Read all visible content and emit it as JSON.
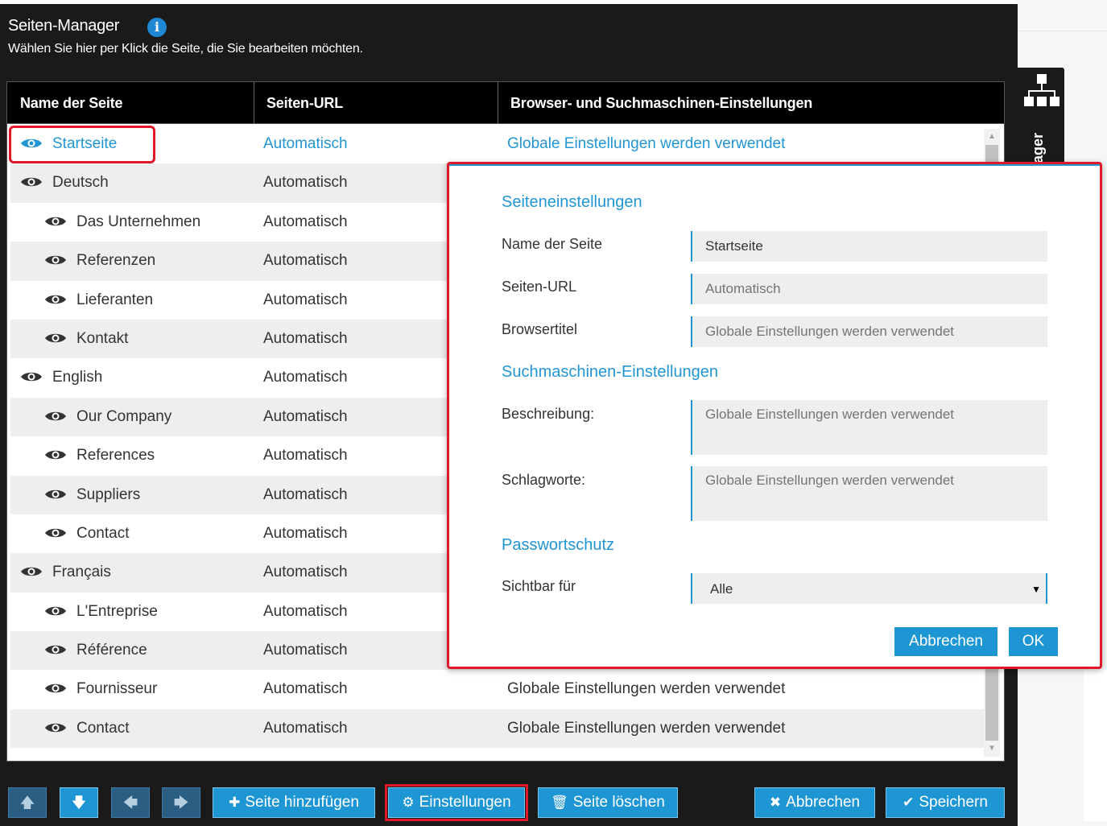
{
  "header": {
    "title": "Seiten-Manager",
    "info_icon": "i",
    "subtitle": "Wählen Sie hier per Klick die Seite, die Sie bearbeiten möchten."
  },
  "side_tab": {
    "label": "ager",
    "icon": "sitemap-icon"
  },
  "table": {
    "columns": [
      "Name der Seite",
      "Seiten-URL",
      "Browser- und Suchmaschinen-Einstellungen"
    ],
    "rows": [
      {
        "name": "Startseite",
        "url": "Automatisch",
        "seo": "Globale Einstellungen werden verwendet"
      },
      {
        "name": "Deutsch",
        "url": "Automatisch",
        "seo": ""
      },
      {
        "name": "Das Unternehmen",
        "url": "Automatisch",
        "seo": ""
      },
      {
        "name": "Referenzen",
        "url": "Automatisch",
        "seo": ""
      },
      {
        "name": "Lieferanten",
        "url": "Automatisch",
        "seo": ""
      },
      {
        "name": "Kontakt",
        "url": "Automatisch",
        "seo": ""
      },
      {
        "name": "English",
        "url": "Automatisch",
        "seo": ""
      },
      {
        "name": "Our Company",
        "url": "Automatisch",
        "seo": ""
      },
      {
        "name": "References",
        "url": "Automatisch",
        "seo": ""
      },
      {
        "name": "Suppliers",
        "url": "Automatisch",
        "seo": ""
      },
      {
        "name": "Contact",
        "url": "Automatisch",
        "seo": ""
      },
      {
        "name": "Français",
        "url": "Automatisch",
        "seo": ""
      },
      {
        "name": "L'Entreprise",
        "url": "Automatisch",
        "seo": ""
      },
      {
        "name": "Référence",
        "url": "Automatisch",
        "seo": ""
      },
      {
        "name": "Fournisseur",
        "url": "Automatisch",
        "seo": "Globale Einstellungen werden verwendet"
      },
      {
        "name": "Contact",
        "url": "Automatisch",
        "seo": "Globale Einstellungen werden verwendet"
      }
    ]
  },
  "dialog": {
    "section_page": "Seiteneinstellungen",
    "label_name": "Name der Seite",
    "value_name": "Startseite",
    "label_url": "Seiten-URL",
    "placeholder_url": "Automatisch",
    "label_browsertitle": "Browsertitel",
    "placeholder_browsertitle": "Globale Einstellungen werden verwendet",
    "section_seo": "Suchmaschinen-Einstellungen",
    "label_description": "Beschreibung:",
    "placeholder_description": "Globale Einstellungen werden verwendet",
    "label_keywords": "Schlagworte:",
    "placeholder_keywords": "Globale Einstellungen werden verwendet",
    "section_password": "Passwortschutz",
    "label_visible": "Sichtbar für",
    "visible_value": "Alle",
    "cancel": "Abbrechen",
    "ok": "OK"
  },
  "toolbar": {
    "up": "🡅",
    "down": "🡇",
    "left": "🡄",
    "right": "🡆",
    "add_page": "Seite hinzufügen",
    "settings": "Einstellungen",
    "delete_page": "Seite löschen",
    "cancel": "Abbrechen",
    "save": "Speichern"
  },
  "colors": {
    "accent": "#1e96d3",
    "highlight": "#e0192a",
    "panel": "#1a1a1a"
  }
}
